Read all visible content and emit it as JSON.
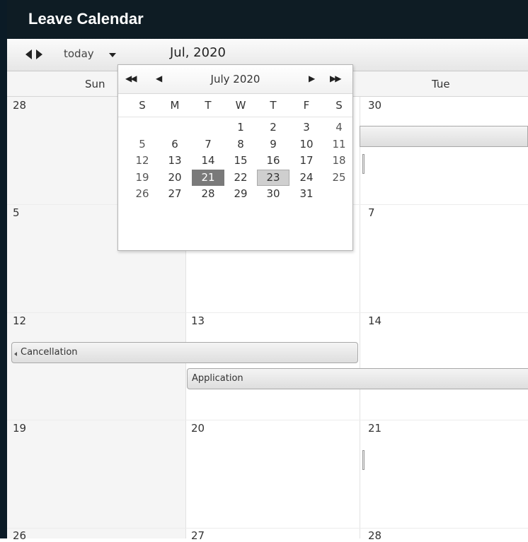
{
  "app": {
    "title": "Leave Calendar"
  },
  "toolbar": {
    "today_label": "today",
    "month_label": "Jul, 2020"
  },
  "headers": {
    "sun": "Sun",
    "tue": "Tue"
  },
  "weeks": [
    {
      "sun": "28",
      "mon": "",
      "tue": "30"
    },
    {
      "sun": "5",
      "mon": "",
      "tue": "7"
    },
    {
      "sun": "12",
      "mon": "13",
      "tue": "14"
    },
    {
      "sun": "19",
      "mon": "20",
      "tue": "21"
    },
    {
      "sun": "26",
      "mon": "27",
      "tue": "28"
    }
  ],
  "events": {
    "cancellation": "Cancellation",
    "application": "Application"
  },
  "datepicker": {
    "title": "July 2020",
    "prev_year": "◀◀",
    "prev_month": "◀",
    "next_month": "▶",
    "next_year": "▶▶",
    "weekdays": [
      "S",
      "M",
      "T",
      "W",
      "T",
      "F",
      "S"
    ],
    "days": [
      [
        "",
        "",
        "",
        "1",
        "2",
        "3",
        "4"
      ],
      [
        "5",
        "6",
        "7",
        "8",
        "9",
        "10",
        "11"
      ],
      [
        "12",
        "13",
        "14",
        "15",
        "16",
        "17",
        "18"
      ],
      [
        "19",
        "20",
        "21",
        "22",
        "23",
        "24",
        "25"
      ],
      [
        "26",
        "27",
        "28",
        "29",
        "30",
        "31",
        ""
      ]
    ],
    "today": "21",
    "selected": "23"
  },
  "colors": {
    "titlebar": "#0e1c24",
    "today_highlight": "#7a7a7a",
    "selected_highlight": "#cfcfcf"
  },
  "icons": {
    "prev": "caret-left-icon",
    "next": "caret-right-icon",
    "dropdown": "caret-down-icon"
  }
}
